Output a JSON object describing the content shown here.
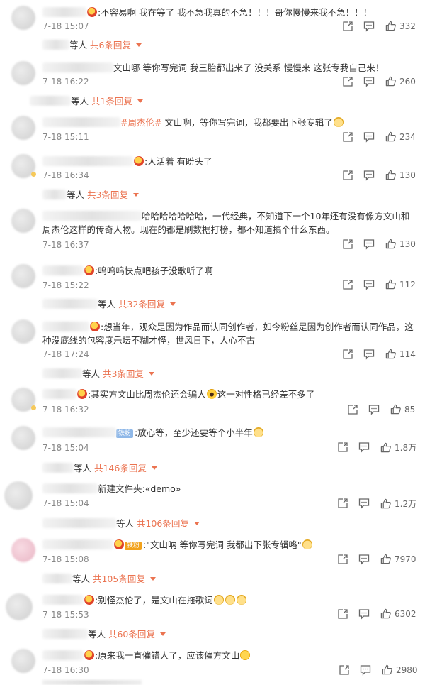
{
  "comments": [
    {
      "text": ":不容易啊 我在等了 我不急我真的不急！！！哥你慢慢来我不急！！！",
      "time": "7-18 15:07",
      "likes": "332"
    },
    {
      "text": "文山哪 等你写完词 我三胎都出来了 没关系 慢慢来 这张专我自己来！",
      "time": "7-18 16:22",
      "likes": "260"
    },
    {
      "topic": "#周杰伦#",
      "text": " 文山啊，等你写完词，我都要出下张专辑了",
      "time": "7-18 15:11",
      "likes": "234"
    },
    {
      "text": ":人活着 有盼头了",
      "time": "7-18 16:34",
      "likes": "130"
    },
    {
      "text": "哈哈哈哈哈哈哈，一代经典，不知道下一个10年还有没有像方文山和周杰伦这样的传奇人物。现在的都是刷数据打榜，都不知道搞个什么东西。",
      "time": "7-18 16:37",
      "likes": "130"
    },
    {
      "text": ":呜呜呜快点吧孩子没歌听了啊",
      "time": "7-18 15:22",
      "likes": "112"
    },
    {
      "text": ":想当年，观众是因为作品而认同创作者，如今粉丝是因为创作者而认同作品，这种没底线的包容度乐坛不糊才怪，世风日下，人心不古",
      "time": "7-18 17:24",
      "likes": "114"
    },
    {
      "text": ":其实方文山比周杰伦还会骗人",
      "text2": "这一对性格已经差不多了",
      "time": "7-18 16:32",
      "likes": "85"
    },
    {
      "tag": "铁粉",
      "text": ":放心等，至少还要等个小半年",
      "time": "7-18 15:04",
      "likes": "1.8万"
    },
    {
      "text": "新建文件夹:«demo»",
      "time": "7-18 15:04",
      "likes": "1.2万"
    },
    {
      "tag": "铁粉",
      "text": ":\"文山呐 等你写完词 我都出下张专辑咯\"",
      "time": "7-18 15:08",
      "likes": "7970"
    },
    {
      "text": ":别怪杰伦了，是文山在拖歌词",
      "time": "7-18 15:53",
      "likes": "6302"
    },
    {
      "text": ":原来我一直催错人了，应该催方文山",
      "time": "7-18 16:30",
      "likes": "2980"
    }
  ],
  "replies": [
    {
      "prefix": "等人 ",
      "count": "共6条回复"
    },
    {
      "prefix": "等人 ",
      "count": "共1条回复"
    },
    {
      "prefix": "等人 ",
      "count": "共3条回复"
    },
    {
      "prefix": "等人 ",
      "count": "共32条回复"
    },
    {
      "prefix": "等人 ",
      "count": "共3条回复"
    },
    {
      "prefix": "等人 ",
      "count": "共146条回复"
    },
    {
      "prefix": "等人 ",
      "count": "共106条回复"
    },
    {
      "prefix": "等人 ",
      "count": "共105条回复"
    },
    {
      "prefix": "等人 ",
      "count": "共60条回复"
    }
  ],
  "icons": {
    "share": "share-icon",
    "comment": "comment-icon",
    "like": "thumb-up-icon",
    "caret": "caret-down-icon"
  },
  "colors": {
    "accent": "#eb7350",
    "text": "#333333",
    "meta": "#888888"
  }
}
